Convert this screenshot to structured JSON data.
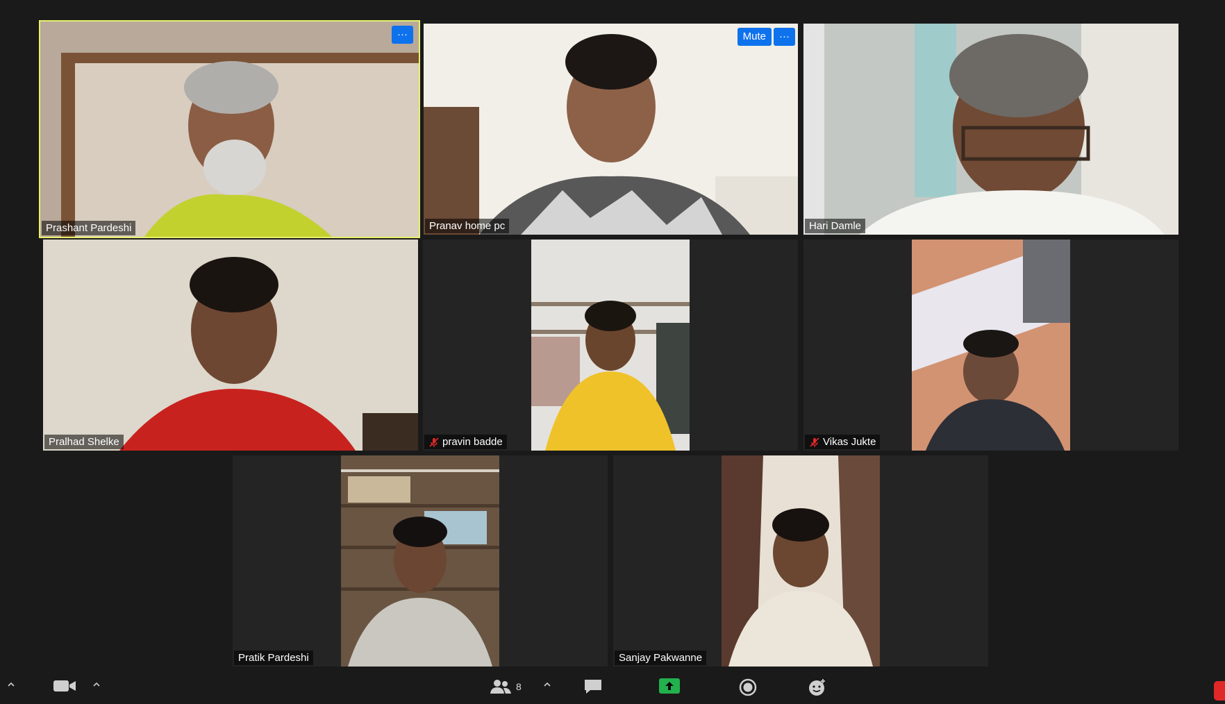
{
  "participants": [
    {
      "name": "Prashant Pardeshi",
      "active": true,
      "muted": false
    },
    {
      "name": "Pranav home pc",
      "active": false,
      "muted": false
    },
    {
      "name": "Hari Damle",
      "active": false,
      "muted": false
    },
    {
      "name": "Pralhad Shelke",
      "active": false,
      "muted": false
    },
    {
      "name": "pravin badde",
      "active": false,
      "muted": true
    },
    {
      "name": "Vikas Jukte",
      "active": false,
      "muted": true
    },
    {
      "name": "Pratik Pardeshi",
      "active": false,
      "muted": false
    },
    {
      "name": "Sanjay Pakwanne",
      "active": false,
      "muted": false
    }
  ],
  "tile_controls": {
    "more_label": "···",
    "mute_label": "Mute"
  },
  "toolbar": {
    "participants_count": "8"
  },
  "colors": {
    "background": "#1a1a1a",
    "tile": "#242424",
    "active_speaker_border": "#e9f06c",
    "button_blue": "#0e72ed",
    "share_green": "#23b14d",
    "mute_red": "#e02828"
  }
}
